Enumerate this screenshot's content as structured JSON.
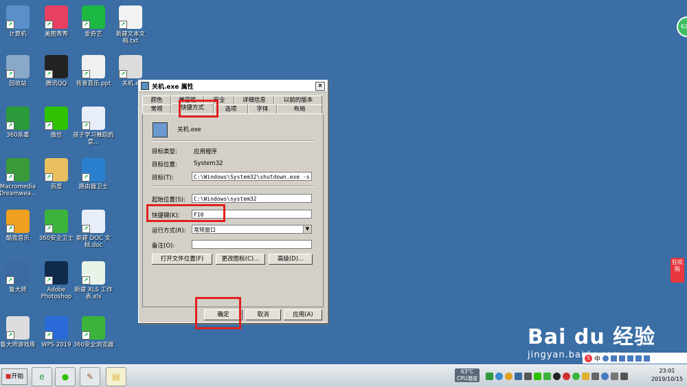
{
  "desktop_icons": [
    {
      "label": "计算机",
      "icon": "computer-icon",
      "color": "#5b8fc9"
    },
    {
      "label": "美图秀秀",
      "icon": "meitu-icon",
      "color": "#e84060"
    },
    {
      "label": "爱奇艺",
      "icon": "iqiyi-icon",
      "color": "#1cb841"
    },
    {
      "label": "新建文本文档.txt",
      "icon": "text-file-icon",
      "color": "#f2f2f2"
    },
    {
      "label": "回收站",
      "icon": "recycle-bin-icon",
      "color": "#8aa8c8"
    },
    {
      "label": "腾讯QQ",
      "icon": "qq-icon",
      "color": "#222222"
    },
    {
      "label": "背景音乐.ppt",
      "icon": "ppt-file-icon",
      "color": "#f0f0f0"
    },
    {
      "label": "关机.e",
      "icon": "shutdown-shortcut-icon",
      "color": "#dddddd"
    },
    {
      "label": "360杀毒",
      "icon": "360-antivirus-icon",
      "color": "#2a9a3a"
    },
    {
      "label": "微信",
      "icon": "wechat-icon",
      "color": "#2dc100"
    },
    {
      "label": "孩子学习舞蹈的意...",
      "icon": "word-file-icon",
      "color": "#e8eef8"
    },
    {
      "label": "Macromedia Dreamwea...",
      "icon": "dreamweaver-icon",
      "color": "#3a9a3a"
    },
    {
      "label": "百度",
      "icon": "folder-icon",
      "color": "#e8c060"
    },
    {
      "label": "路由器卫士",
      "icon": "router-icon",
      "color": "#2a80d0"
    },
    {
      "label": "酷我音乐",
      "icon": "kuwo-icon",
      "color": "#f0a020"
    },
    {
      "label": "360安全卫士",
      "icon": "360-safe-icon",
      "color": "#3cb43c"
    },
    {
      "label": "新建 DOC 文档.doc",
      "icon": "doc-file-icon",
      "color": "#e8eef8"
    },
    {
      "label": "鲁大师",
      "icon": "ludashi-icon",
      "color": "#3a6aa0"
    },
    {
      "label": "Adobe Photoshop",
      "icon": "photoshop-icon",
      "color": "#0f2a4a"
    },
    {
      "label": "新建 XLS 工作表.xls",
      "icon": "xls-file-icon",
      "color": "#e8f4e8"
    },
    {
      "label": "鲁大师游戏库",
      "icon": "game-pad-icon",
      "color": "#dddddd"
    },
    {
      "label": "WPS 2019",
      "icon": "wps-icon",
      "color": "#2a6ad8"
    },
    {
      "label": "360安全浏览器",
      "icon": "360-browser-icon",
      "color": "#3cb43c"
    }
  ],
  "dialog": {
    "title": "关机.exe 属性",
    "close": "×",
    "tabs_back": [
      "颜色",
      "兼容性",
      "安全",
      "详细信息",
      "以前的版本"
    ],
    "tabs_front": [
      "常规",
      "快捷方式",
      "选项",
      "字体",
      "布局"
    ],
    "file_name": "关机.exe",
    "target_type_label": "目标类型:",
    "target_type_value": "应用程序",
    "target_location_label": "目标位置:",
    "target_location_value": "System32",
    "target_label": "目标(T):",
    "target_value": "C:\\Windows\\System32\\shutdown.exe -s",
    "start_in_label": "起始位置(S):",
    "start_in_value": "C:\\Windows\\system32",
    "shortcut_key_label": "快捷键(K):",
    "shortcut_key_value": "F10",
    "run_label": "运行方式(R):",
    "run_value": "常规窗口",
    "comment_label": "备注(O):",
    "comment_value": "",
    "open_location_btn": "打开文件位置(F)",
    "change_icon_btn": "更改图标(C)...",
    "advanced_btn": "高级(D)...",
    "ok_btn": "确定",
    "cancel_btn": "取消",
    "apply_btn": "应用(A)"
  },
  "taskbar": {
    "start": "开始",
    "cpu_temp": "63°C",
    "cpu_label": "CPU温度",
    "time": "23:01",
    "date": "2019/10/15"
  },
  "watermark": {
    "brand": "Bai du 经验",
    "url": "jingyan.baidu.com"
  },
  "badge": "62",
  "side_tag": "狂欢购",
  "ime": "中"
}
